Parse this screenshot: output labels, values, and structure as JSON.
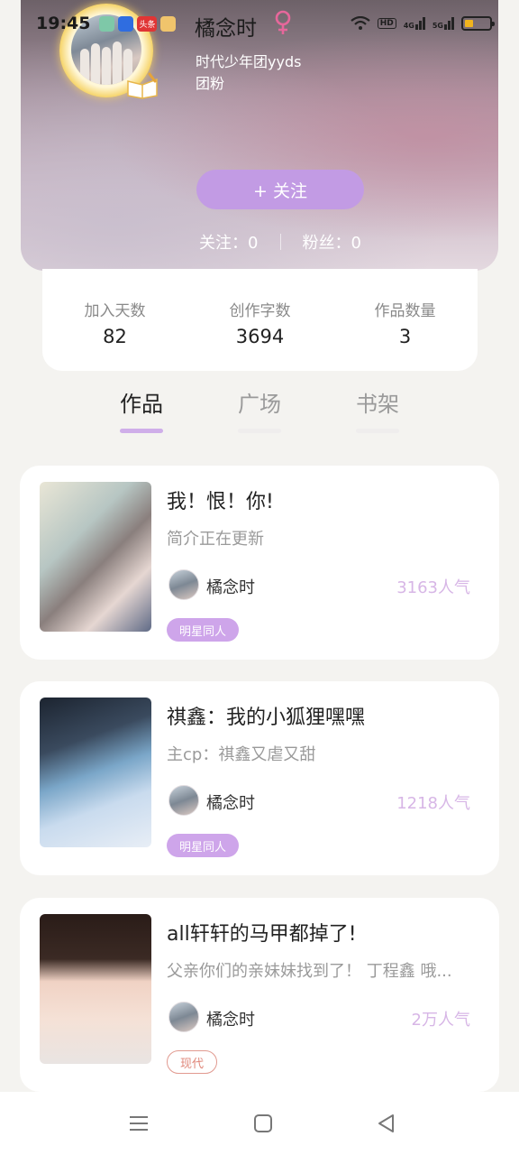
{
  "status_bar": {
    "time": "19:45",
    "app_badge_text": "头条",
    "network_labels": [
      "HD",
      "4G",
      "5G"
    ]
  },
  "profile": {
    "username": "橘念时",
    "gender_icon": "female-icon",
    "bio": "时代少年团yyds\n团粉",
    "follow_button_label": "+ 关注",
    "following": "关注：0",
    "fans": "粉丝：0"
  },
  "summary": [
    {
      "label": "加入天数",
      "value": "82"
    },
    {
      "label": "创作字数",
      "value": "3694"
    },
    {
      "label": "作品数量",
      "value": "3"
    }
  ],
  "tabs": [
    {
      "label": "作品",
      "active": true
    },
    {
      "label": "广场",
      "active": false
    },
    {
      "label": "书架",
      "active": false
    }
  ],
  "works": [
    {
      "title": "我！恨！你!",
      "description": "简介正在更新",
      "author": "橘念时",
      "popularity": "3163人气",
      "tag": "明星同人",
      "tag_style": "filled"
    },
    {
      "title": "祺鑫：我的小狐狸嘿嘿",
      "description": "主cp：祺鑫又虐又甜",
      "author": "橘念时",
      "popularity": "1218人气",
      "tag": "明星同人",
      "tag_style": "filled"
    },
    {
      "title": "all轩轩的马甲都掉了!",
      "description": "父亲你们的亲妹妹找到了！ 丁程鑫 哦...",
      "author": "橘念时",
      "popularity": "2万人气",
      "tag": "现代",
      "tag_style": "outline"
    }
  ],
  "colors": {
    "accent": "#c29be4",
    "popularity": "#d7b6e6",
    "tag_filled": "#cea5ea",
    "tag_outline": "#e19a90"
  }
}
